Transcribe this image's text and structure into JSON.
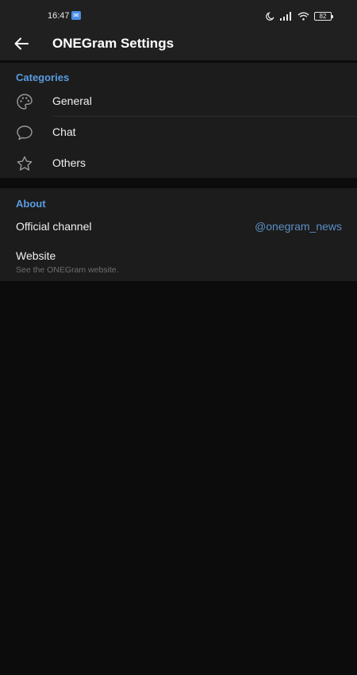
{
  "status_bar": {
    "time": "16:47",
    "notification_icon": "app-notification-icon",
    "battery_level": "82",
    "icons": [
      "moon-icon",
      "signal-icon",
      "wifi-icon",
      "battery-icon"
    ]
  },
  "app_bar": {
    "title": "ONEGram Settings",
    "back_icon": "arrow-left-icon"
  },
  "categories": {
    "header": "Categories",
    "items": [
      {
        "label": "General",
        "icon": "palette-icon"
      },
      {
        "label": "Chat",
        "icon": "chat-bubble-icon"
      },
      {
        "label": "Others",
        "icon": "star-icon"
      }
    ]
  },
  "about": {
    "header": "About",
    "official_channel": {
      "label": "Official channel",
      "value": "@onegram_news"
    },
    "website": {
      "label": "Website",
      "subtitle": "See the ONEGram website."
    }
  },
  "colors": {
    "accent": "#5a9be0",
    "link": "#5a8fc5",
    "background": "#0c0c0c",
    "section_bg": "#1c1c1c",
    "bar_bg": "#202020"
  }
}
